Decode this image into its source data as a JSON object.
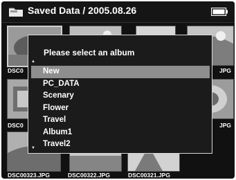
{
  "header": {
    "title": "Saved Data / 2005.08.26",
    "folder_icon": "folder-icon",
    "battery_icon": "battery-full-icon"
  },
  "files": {
    "row1_left": "DSC0",
    "row1_right": "JPG",
    "row2_left": "DSC0",
    "row2_right": "JPG",
    "row3": [
      "DSC00323.JPG",
      "DSC00322.JPG",
      "DSC00321.JPG"
    ]
  },
  "dialog": {
    "title": "Please select an album",
    "scroll_up": "▲",
    "scroll_down": "▼",
    "albums": [
      "New",
      "PC_DATA",
      "Scenary",
      "Flower",
      "Travel",
      "Album1",
      "Travel2"
    ],
    "selected_index": 0
  }
}
